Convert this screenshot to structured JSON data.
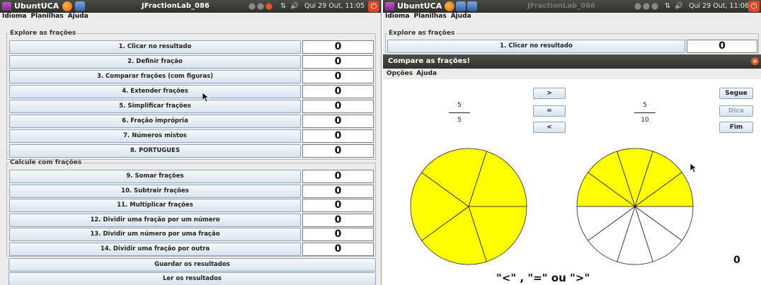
{
  "left": {
    "topbar": {
      "brand": "UbuntUCA",
      "title": "JFractionLab_086",
      "status": "Qui 29 Out, 11:05",
      "power": "⏻"
    },
    "menu": [
      "Idioma",
      "Planilhas",
      "Ajuda"
    ],
    "group1": {
      "legend": "Explore as frações",
      "rows": [
        {
          "label": "1. Clicar no resultado",
          "score": "0"
        },
        {
          "label": "2. Definir fração",
          "score": "0"
        },
        {
          "label": "3. Comparar frações (com figuras)",
          "score": "0"
        },
        {
          "label": "4. Extender frações",
          "score": "0"
        },
        {
          "label": "5. Simplificar frações",
          "score": "0"
        },
        {
          "label": "6. Fração imprópria",
          "score": "0"
        },
        {
          "label": "7. Números mistos",
          "score": "0"
        },
        {
          "label": "8. PORTUGUES",
          "score": "0"
        }
      ]
    },
    "group2": {
      "legend": "Calcule com frações",
      "rows": [
        {
          "label": "9. Somar frações",
          "score": "0"
        },
        {
          "label": "10. Subtrair frações",
          "score": "0"
        },
        {
          "label": "11. Multiplicar frações",
          "score": "0"
        },
        {
          "label": "12. Dividir uma fração por um número",
          "score": "0"
        },
        {
          "label": "13. Dividir um número por uma fração",
          "score": "0"
        },
        {
          "label": "14. Dividir uma fração por outra",
          "score": "0"
        }
      ]
    },
    "save_label": "Guardar os resultados",
    "read_label": "Ler os resultados"
  },
  "right": {
    "topbar": {
      "brand": "UbuntUCA",
      "title": "JFractionLab_086",
      "status": "Qui 29 Out, 11:06",
      "power": "⏻"
    },
    "menu": [
      "Idioma",
      "Planilhas",
      "Ajuda"
    ],
    "group_legend": "Explore as frações",
    "row1": {
      "label": "1. Clicar no resultado",
      "score": "0"
    },
    "dialog": {
      "title": "Compare as frações!",
      "close": "×",
      "menu": [
        "Opções",
        "Ajuda"
      ],
      "left_fraction": {
        "numerator": "5",
        "denominator": "5",
        "slices": 5,
        "filled": 5
      },
      "right_fraction": {
        "numerator": "5",
        "denominator": "10",
        "slices": 10,
        "filled": 5
      },
      "compare_buttons": [
        ">",
        "=",
        "<"
      ],
      "side_buttons": [
        "Segue",
        "Dica",
        "Fim"
      ],
      "score": "0",
      "instruction": "\"<\" , \"=\" ou \">\""
    }
  },
  "colors": {
    "fill": "#ffff00",
    "empty": "#ffffff",
    "stroke": "#222222"
  }
}
